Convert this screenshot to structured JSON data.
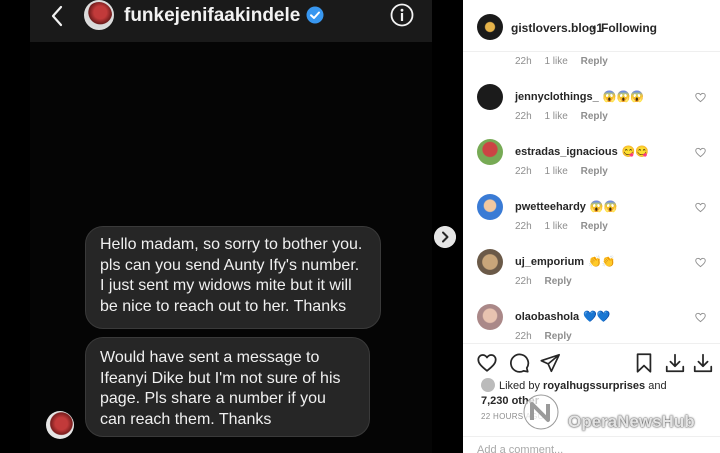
{
  "dm": {
    "username": "funkejenifaakindele",
    "messages": [
      "Hello madam, so sorry to bother you. pls can you send Aunty Ify's number. I just sent my widows mite but it will be nice to reach out to her. Thanks",
      "Would have sent a message to Ifeanyi Dike but I'm not sure of his page. Pls share a number if you can reach them. Thanks"
    ]
  },
  "post": {
    "owner": "gistlovers.blog1",
    "separator": "•",
    "follow_status": "Following"
  },
  "comments": [
    {
      "user": "",
      "text": "",
      "time": "22h",
      "likes": "1 like",
      "reply": "Reply"
    },
    {
      "user": "jennyclothings_",
      "text": "😱😱😱",
      "time": "22h",
      "likes": "1 like",
      "reply": "Reply"
    },
    {
      "user": "estradas_ignacious",
      "text": "😋😋",
      "time": "22h",
      "likes": "1 like",
      "reply": "Reply"
    },
    {
      "user": "pwetteehardy",
      "text": "😱😱",
      "time": "22h",
      "likes": "1 like",
      "reply": "Reply"
    },
    {
      "user": "uj_emporium",
      "text": "👏👏",
      "time": "22h",
      "likes": "",
      "reply": "Reply"
    },
    {
      "user": "olaobashola",
      "text": "💙💙",
      "time": "22h",
      "likes": "",
      "reply": "Reply"
    }
  ],
  "likes": {
    "prefix": "Liked by",
    "user": "royalhugssurprises",
    "and": "and",
    "count": "7,230 other",
    "suffix": ""
  },
  "time_ago": "22 HOURS AGO",
  "add_comment_placeholder": "Add a comment...",
  "watermark": "OperaNewsHub",
  "colors": {
    "bubble": "#262626",
    "verified": "#3897f0",
    "link_text": "#262626",
    "muted": "#8e8e8e"
  },
  "icons": [
    "back-icon",
    "verified-icon",
    "info-icon",
    "chevron-right-icon",
    "heart-icon",
    "comment-icon",
    "share-icon",
    "save-icon",
    "download-icon"
  ]
}
